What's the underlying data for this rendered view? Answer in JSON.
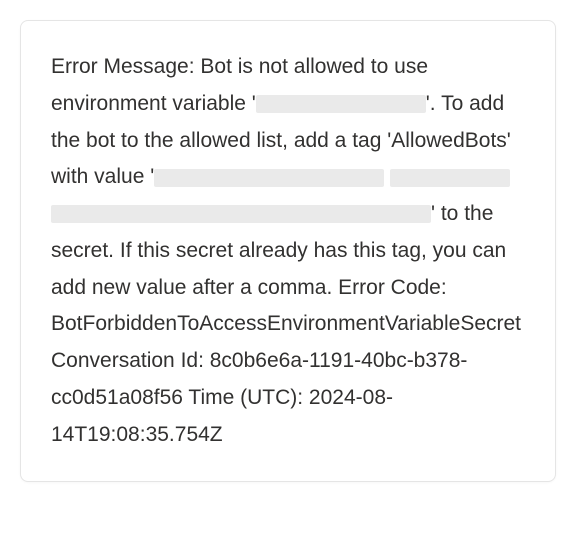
{
  "error": {
    "prefix": "Error Message: Bot is not allowed to use environment variable '",
    "mid1": "'. To add the bot to the allowed list, add a tag 'AllowedBots' with value '",
    "mid2": "' to the secret. If this secret already has this tag, you can add new value after a comma. Error Code: BotForbiddenToAccessEnvironmentVariableSecret Conversation Id: 8c0b6e6a-1191-40bc-b378-cc0d51a08f56 Time (UTC): 2024-08-14T19:08:35.754Z"
  }
}
